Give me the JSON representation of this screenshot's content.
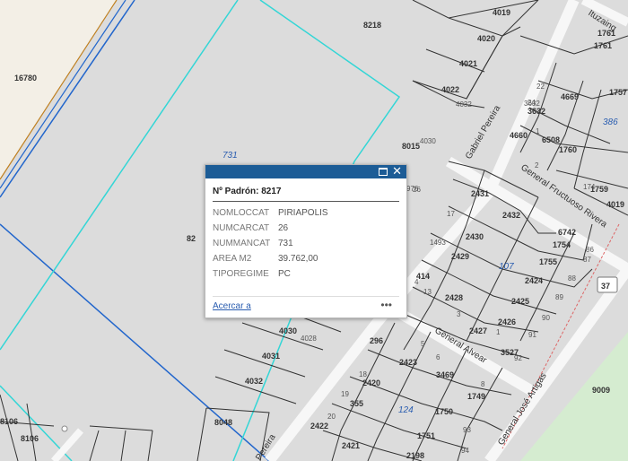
{
  "map": {
    "parcels": [
      "8218",
      "4019",
      "4020",
      "4021",
      "4022",
      "4032",
      "8015",
      "4030",
      "976",
      "2431",
      "2432",
      "2430",
      "2429",
      "414",
      "2428",
      "2425",
      "2424",
      "1755",
      "1754",
      "6742",
      "2426",
      "2427",
      "3527",
      "296",
      "2423",
      "3469",
      "2420",
      "1749",
      "355",
      "1750",
      "2422",
      "1751",
      "2421",
      "2198",
      "4030",
      "4028",
      "4031",
      "4032",
      "8106",
      "8106",
      "8048",
      "1761",
      "1761",
      "4669",
      "3632",
      "6508",
      "1760",
      "4660",
      "1759",
      "1757",
      "4019",
      "9009",
      "82",
      "16780"
    ],
    "sub_labels": [
      "22",
      "24",
      "3632",
      "2",
      "1",
      "17",
      "1493",
      "13",
      "4",
      "3",
      "5",
      "6",
      "8",
      "18",
      "19",
      "20",
      "93",
      "94",
      "92",
      "91",
      "90",
      "89",
      "88",
      "87",
      "86",
      "1",
      "174",
      "26"
    ],
    "blue_labels": [
      "731",
      "386",
      "107",
      "124",
      "37"
    ],
    "streets": {
      "gabriel_pereira": "Gabriel Pereira",
      "fructuoso_rivera": "General Fructuoso Rivera",
      "alvear": "General Alvear",
      "artigas": "General José Artigas",
      "ituzaingo": "Ituzaing",
      "pereira_bottom": "Pereira"
    },
    "colors": {
      "background": "#dcdcdc",
      "parcel_line": "#333333",
      "cyan_line": "#33d6d6",
      "blue_line": "#2266cc",
      "orange_line": "#c08020",
      "green_zone": "#d5ecd0"
    }
  },
  "popup": {
    "title": "Nº Padrón: 8217",
    "fields": [
      {
        "key": "NOMLOCCAT",
        "value": "PIRIAPOLIS"
      },
      {
        "key": "NUMCARCAT",
        "value": "26"
      },
      {
        "key": "NUMMANCAT",
        "value": "731"
      },
      {
        "key": "AREA M2",
        "value": "39.762,00"
      },
      {
        "key": "TIPOREGIME",
        "value": "PC"
      }
    ],
    "zoom_link": "Acercar a",
    "more_label": "•••",
    "close_icon": "close-icon",
    "maximize_icon": "maximize-icon"
  }
}
